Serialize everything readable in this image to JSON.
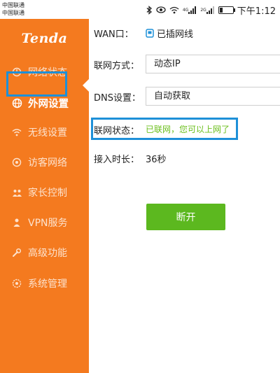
{
  "statusbar": {
    "carrier_1": "中国联通",
    "carrier_2": "中国联通",
    "time": "下午1:12",
    "signal_tag_1": "4G",
    "signal_tag_2": "2G"
  },
  "sidebar": {
    "logo": "Tenda",
    "items": [
      {
        "label": "网络状态",
        "icon": "network-status-icon"
      },
      {
        "label": "外网设置",
        "icon": "globe-icon",
        "active": true
      },
      {
        "label": "无线设置",
        "icon": "wifi-icon"
      },
      {
        "label": "访客网络",
        "icon": "guest-icon"
      },
      {
        "label": "家长控制",
        "icon": "parental-control-icon"
      },
      {
        "label": "VPN服务",
        "icon": "vpn-icon"
      },
      {
        "label": "高级功能",
        "icon": "advanced-icon"
      },
      {
        "label": "系统管理",
        "icon": "settings-icon"
      }
    ]
  },
  "main": {
    "wan_label": "WAN口：",
    "wan_value": "已插网线",
    "conn_mode_label": "联网方式：",
    "conn_mode_value": "动态IP",
    "dns_label": "DNS设置：",
    "dns_value": "自动获取",
    "conn_status_label": "联网状态：",
    "conn_status_value": "已联网，您可以上网了",
    "uptime_label": "接入时长：",
    "uptime_value": "36秒",
    "disconnect_button": "断开"
  },
  "colors": {
    "sidebar_bg": "#f47a1f",
    "highlight_border": "#1e90d8",
    "success_text": "#6bbf1c",
    "button_bg": "#5cb81f"
  }
}
